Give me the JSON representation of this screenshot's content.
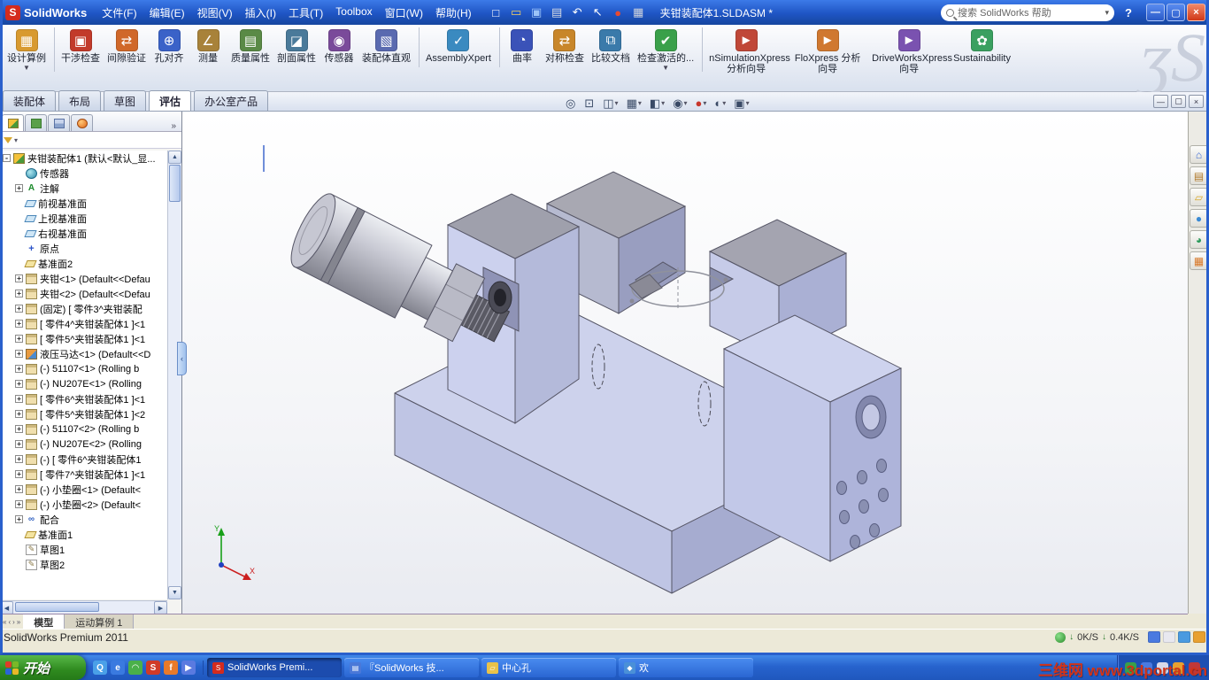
{
  "titlebar": {
    "app_name": "SolidWorks",
    "doc_name": "夹钳装配体1.SLDASM *",
    "search_text": "搜索 SolidWorks 帮助",
    "help_label": "?",
    "min_glyph": "—",
    "max_glyph": "▢",
    "close_glyph": "×",
    "menus": [
      {
        "label": "文件(F)"
      },
      {
        "label": "编辑(E)"
      },
      {
        "label": "视图(V)"
      },
      {
        "label": "插入(I)"
      },
      {
        "label": "工具(T)"
      },
      {
        "label": "Toolbox"
      },
      {
        "label": "窗口(W)"
      },
      {
        "label": "帮助(H)"
      }
    ],
    "quick_toolbar": [
      {
        "name": "new-document-icon",
        "glyph": "□",
        "color": "#ffffff"
      },
      {
        "name": "open-icon",
        "glyph": "▭",
        "color": "#f4d060"
      },
      {
        "name": "save-icon",
        "glyph": "▣",
        "color": "#9cc4f8"
      },
      {
        "name": "print-icon",
        "glyph": "▤",
        "color": "#d8dce4"
      },
      {
        "name": "undo-icon",
        "glyph": "↶",
        "color": "#ffffff"
      },
      {
        "name": "select-cursor-icon",
        "glyph": "↖",
        "color": "#ffffff"
      },
      {
        "name": "rebuild-icon",
        "glyph": "●",
        "color": "#e84a30"
      },
      {
        "name": "options-icon",
        "glyph": "▦",
        "color": "#d0d4dc"
      }
    ]
  },
  "ribbon": {
    "watermark": "ʒS",
    "buttons": [
      {
        "label": "设计算例",
        "glyph": "▦",
        "color": "#d89a30",
        "sep": "sep",
        "caret": "▼"
      },
      {
        "label": "干涉检查",
        "glyph": "▣",
        "color": "#c23a2a",
        "sep": "",
        "caret": ""
      },
      {
        "label": "间隙验证",
        "glyph": "⇄",
        "color": "#d0682a",
        "sep": "",
        "caret": ""
      },
      {
        "label": "孔对齐",
        "glyph": "⊕",
        "color": "#3a62c8",
        "sep": "",
        "caret": ""
      },
      {
        "label": "测量",
        "glyph": "∠",
        "color": "#a8823a",
        "sep": "",
        "caret": ""
      },
      {
        "label": "质量属性",
        "glyph": "▤",
        "color": "#5a8a46",
        "sep": "",
        "caret": ""
      },
      {
        "label": "剖面属性",
        "glyph": "◪",
        "color": "#4a7a9a",
        "sep": "",
        "caret": ""
      },
      {
        "label": "传感器",
        "glyph": "◉",
        "color": "#7a4a9a",
        "sep": "",
        "caret": ""
      },
      {
        "label": "装配体直观",
        "glyph": "▧",
        "color": "#5a6ab0",
        "sep": "sep",
        "caret": ""
      },
      {
        "label": "AssemblyXpert",
        "glyph": "✓",
        "color": "#3a8ac0",
        "sep": "sep",
        "caret": ""
      },
      {
        "label": "曲率",
        "glyph": "◔",
        "color": "#3a52b8",
        "sep": "",
        "caret": ""
      },
      {
        "label": "对称检查",
        "glyph": "⇄",
        "color": "#c8862a",
        "sep": "",
        "caret": ""
      },
      {
        "label": "比较文档",
        "glyph": "⧉",
        "color": "#3a7aaa",
        "sep": "",
        "caret": ""
      },
      {
        "label": "检查激活的...",
        "glyph": "✔",
        "color": "#3aa04a",
        "sep": "sep",
        "caret": "▼"
      },
      {
        "label": "nSimulationXpress 分析向导",
        "glyph": "►",
        "color": "#c04838",
        "sep": "",
        "caret": ""
      },
      {
        "label": "FloXpress 分析向导",
        "glyph": "►",
        "color": "#d07830",
        "sep": "",
        "caret": ""
      },
      {
        "label": "DriveWorksXpress 向导",
        "glyph": "►",
        "color": "#7a52b0",
        "sep": "",
        "caret": ""
      },
      {
        "label": "Sustainability",
        "glyph": "✿",
        "color": "#3aa060",
        "sep": "",
        "caret": ""
      }
    ]
  },
  "command_tabs": {
    "tabs": [
      {
        "label": "装配体",
        "state": ""
      },
      {
        "label": "布局",
        "state": ""
      },
      {
        "label": "草图",
        "state": ""
      },
      {
        "label": "评估",
        "state": "active"
      },
      {
        "label": "办公室产品",
        "state": ""
      }
    ],
    "doc_min": "—",
    "doc_restore": "▢",
    "doc_close": "×"
  },
  "hud": {
    "buttons": [
      {
        "name": "zoom-fit-icon",
        "glyph": "◎",
        "caret": ""
      },
      {
        "name": "zoom-area-icon",
        "glyph": "⊡",
        "caret": ""
      },
      {
        "name": "section-view-icon",
        "glyph": "◫",
        "caret": "▾"
      },
      {
        "name": "view-orientation-icon",
        "glyph": "▦",
        "caret": "▾"
      },
      {
        "name": "display-style-icon",
        "glyph": "◧",
        "caret": "▾"
      },
      {
        "name": "hide-show-items-icon",
        "glyph": "◉",
        "caret": "▾"
      },
      {
        "name": "edit-appearance-icon",
        "glyph": "●",
        "caret": "▾",
        "color": "#c8372d"
      },
      {
        "name": "apply-scene-icon",
        "glyph": "◐",
        "caret": "▾"
      },
      {
        "name": "view-settings-icon",
        "glyph": "▣",
        "caret": "▾"
      }
    ]
  },
  "tree": {
    "items": [
      {
        "label": "夹钳装配体1 (默认<默认_显...",
        "icon": "assembly-icon",
        "expander": "minus",
        "ind": "i0"
      },
      {
        "label": "传感器",
        "icon": "sensor-icon",
        "expander": "none",
        "ind": "i1"
      },
      {
        "label": "注解",
        "icon": "annotations-icon",
        "expander": "plus",
        "ind": "i1"
      },
      {
        "label": "前视基准面",
        "icon": "plane-icon",
        "expander": "none",
        "ind": "i1"
      },
      {
        "label": "上视基准面",
        "icon": "plane-icon",
        "expander": "none",
        "ind": "i1"
      },
      {
        "label": "右视基准面",
        "icon": "plane-icon",
        "expander": "none",
        "ind": "i1"
      },
      {
        "label": "原点",
        "icon": "origin-icon",
        "expander": "none",
        "ind": "i1"
      },
      {
        "label": "基准面2",
        "icon": "plane-gold-icon",
        "expander": "none",
        "ind": "i1"
      },
      {
        "label": "夹钳<1> (Default<<Defau",
        "icon": "part-icon",
        "expander": "plus",
        "ind": "i1"
      },
      {
        "label": "夹钳<2> (Default<<Defau",
        "icon": "part-icon",
        "expander": "plus",
        "ind": "i1"
      },
      {
        "label": "(固定) [ 零件3^夹钳装配",
        "icon": "part-icon",
        "expander": "plus",
        "ind": "i1"
      },
      {
        "label": "[ 零件4^夹钳装配体1 ]<1",
        "icon": "part-icon",
        "expander": "plus",
        "ind": "i1"
      },
      {
        "label": "[ 零件5^夹钳装配体1 ]<1",
        "icon": "part-icon",
        "expander": "plus",
        "ind": "i1"
      },
      {
        "label": "液压马达<1> (Default<<D",
        "icon": "subassembly-icon",
        "expander": "plus",
        "ind": "i1"
      },
      {
        "label": "(-) 51107<1> (Rolling b",
        "icon": "part-icon",
        "expander": "plus",
        "ind": "i1"
      },
      {
        "label": "(-) NU207E<1> (Rolling",
        "icon": "part-icon",
        "expander": "plus",
        "ind": "i1"
      },
      {
        "label": "[ 零件6^夹钳装配体1 ]<1",
        "icon": "part-icon",
        "expander": "plus",
        "ind": "i1"
      },
      {
        "label": "[ 零件5^夹钳装配体1 ]<2",
        "icon": "part-icon",
        "expander": "plus",
        "ind": "i1"
      },
      {
        "label": "(-) 51107<2> (Rolling b",
        "icon": "part-icon",
        "expander": "plus",
        "ind": "i1"
      },
      {
        "label": "(-) NU207E<2> (Rolling",
        "icon": "part-icon",
        "expander": "plus",
        "ind": "i1"
      },
      {
        "label": "(-) [ 零件6^夹钳装配体1",
        "icon": "part-icon",
        "expander": "plus",
        "ind": "i1"
      },
      {
        "label": "[ 零件7^夹钳装配体1 ]<1",
        "icon": "part-icon",
        "expander": "plus",
        "ind": "i1"
      },
      {
        "label": "(-) 小垫圈<1> (Default<",
        "icon": "part-icon",
        "expander": "plus",
        "ind": "i1"
      },
      {
        "label": "(-) 小垫圈<2> (Default<",
        "icon": "part-icon",
        "expander": "plus",
        "ind": "i1"
      },
      {
        "label": "配合",
        "icon": "mates-icon",
        "expander": "plus",
        "ind": "i1"
      },
      {
        "label": "基准面1",
        "icon": "plane-gold-icon",
        "expander": "none",
        "ind": "i1"
      },
      {
        "label": "草图1",
        "icon": "sketch-icon",
        "expander": "none",
        "ind": "i1"
      },
      {
        "label": "草图2",
        "icon": "sketch-icon",
        "expander": "none",
        "ind": "i1"
      }
    ]
  },
  "rail": {
    "buttons": [
      {
        "name": "home-icon",
        "glyph": "⌂",
        "color": "#3a6ad4"
      },
      {
        "name": "design-library-icon",
        "glyph": "▤",
        "color": "#b07828"
      },
      {
        "name": "file-explorer-icon",
        "glyph": "▱",
        "color": "#d8a828"
      },
      {
        "name": "view-palette-icon",
        "glyph": "●",
        "color": "#3a8ad4"
      },
      {
        "name": "appearances-icon",
        "glyph": "◕",
        "color": "#2a9a5a"
      },
      {
        "name": "custom-properties-icon",
        "glyph": "▦",
        "color": "#d87828"
      }
    ]
  },
  "model_tabs": {
    "nav": [
      {
        "glyph": "«"
      },
      {
        "glyph": "‹"
      },
      {
        "glyph": "›"
      },
      {
        "glyph": "»"
      }
    ],
    "tabs": [
      {
        "label": "模型",
        "state": "active"
      },
      {
        "label": "运动算例 1",
        "state": ""
      }
    ]
  },
  "statusbar": {
    "text": "SolidWorks Premium 2011",
    "net_down": "0K/S",
    "net_up": "0.4K/S",
    "down_glyph": "↓",
    "icons": [
      {
        "name": "lock-icon",
        "color": "#4a7ae0"
      },
      {
        "name": "arrow-up-icon",
        "color": "#e8e8f0"
      },
      {
        "name": "message-icon",
        "color": "#4a9ae0"
      },
      {
        "name": "ime-icon",
        "color": "#e8a030"
      }
    ]
  },
  "taskbar": {
    "start_label": "开始",
    "quick_launch": [
      {
        "name": "qq-icon",
        "glyph": "Q",
        "color": "#4aa0e8"
      },
      {
        "name": "ie-icon",
        "glyph": "e",
        "color": "#3a7ae0"
      },
      {
        "name": "browser-icon",
        "glyph": "◠",
        "color": "#4ab04a"
      },
      {
        "name": "solidworks-icon",
        "glyph": "S",
        "color": "#d03a28"
      },
      {
        "name": "firefox-icon",
        "glyph": "f",
        "color": "#e87a2a"
      },
      {
        "name": "media-player-icon",
        "glyph": "▶",
        "color": "#5a7ae0"
      }
    ],
    "tasks": [
      {
        "label": "SolidWorks Premi...",
        "state": "active",
        "color": "#d42b1e",
        "glyph": "S"
      },
      {
        "label": "『SolidWorks 技...",
        "state": "",
        "color": "#4a78d8",
        "glyph": "▤"
      },
      {
        "label": "中心孔",
        "state": "",
        "color": "#e8c24a",
        "glyph": "▱"
      },
      {
        "label": "欢",
        "state": "",
        "color": "#4a90d8",
        "glyph": "◆"
      }
    ],
    "tray_icons": [
      {
        "name": "safety-shield-icon",
        "color": "#3aa04a"
      },
      {
        "name": "download-icon",
        "color": "#4a7ae0"
      },
      {
        "name": "volume-icon",
        "color": "#d8d8e8"
      },
      {
        "name": "network-icon",
        "color": "#e8a030"
      },
      {
        "name": "ime-icon",
        "color": "#c03838"
      }
    ]
  },
  "watermark": "三维网 www.3dportal.cn"
}
